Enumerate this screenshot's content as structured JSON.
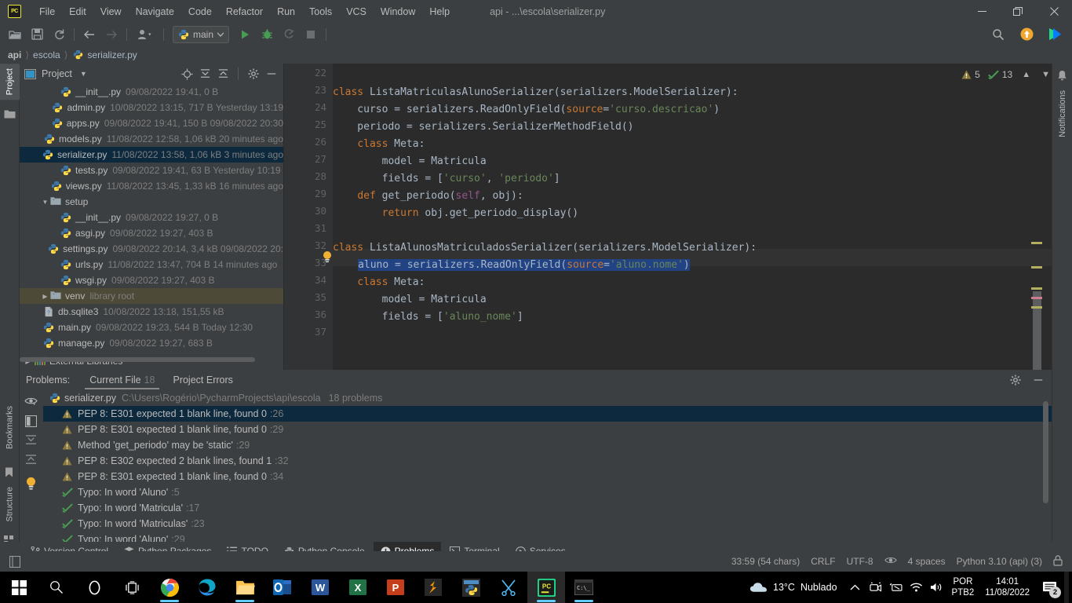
{
  "titlebar": {
    "logo": "PC",
    "menus": [
      "File",
      "Edit",
      "View",
      "Navigate",
      "Code",
      "Refactor",
      "Run",
      "Tools",
      "VCS",
      "Window",
      "Help"
    ],
    "window_title": "api - ...\\escola\\serializer.py",
    "minimize": "minimize-icon",
    "maximize": "restore-icon",
    "close": "close-icon"
  },
  "toolbar": {
    "open_label": "open-folder-icon",
    "save_label": "save-icon",
    "sync_label": "sync-icon",
    "back_label": "back-arrow-icon",
    "forward_label": "forward-arrow-icon",
    "profile_label": "user-icon",
    "run_config": "main",
    "run_label": "run-icon",
    "debug_label": "debug-icon",
    "coverage_label": "coverage-icon",
    "stop_label": "stop-icon",
    "search_label": "search-icon",
    "update_label": "update-icon",
    "plugin_label": "plugin-icon"
  },
  "breadcrumb": {
    "items": [
      "api",
      "escola",
      "serializer.py"
    ]
  },
  "left_strip": {
    "project_tab": "Project",
    "bookmarks_tab": "Bookmarks",
    "structure_tab": "Structure"
  },
  "right_strip": {
    "notifications_tab": "Notifications"
  },
  "project_panel": {
    "title": "Project",
    "icons": [
      "locate-icon",
      "expand-all-icon",
      "collapse-all-icon",
      "gear-icon",
      "minimize-icon"
    ],
    "tree": [
      {
        "indent": 4,
        "icon": "python-file-icon",
        "name": "__init__.py",
        "meta": "09/08/2022 19:41, 0 B",
        "state": ""
      },
      {
        "indent": 4,
        "icon": "python-file-icon",
        "name": "admin.py",
        "meta": "10/08/2022 13:15, 717 B Yesterday 13:19",
        "state": ""
      },
      {
        "indent": 4,
        "icon": "python-file-icon",
        "name": "apps.py",
        "meta": "09/08/2022 19:41, 150 B 09/08/2022 20:30",
        "state": ""
      },
      {
        "indent": 4,
        "icon": "python-file-icon",
        "name": "models.py",
        "meta": "11/08/2022 12:58, 1,06 kB 20 minutes ago",
        "state": ""
      },
      {
        "indent": 4,
        "icon": "python-file-icon",
        "name": "serializer.py",
        "meta": "11/08/2022 13:58, 1,06 kB 3 minutes ago",
        "state": "selected"
      },
      {
        "indent": 4,
        "icon": "python-file-icon",
        "name": "tests.py",
        "meta": "09/08/2022 19:41, 63 B Yesterday 10:19",
        "state": ""
      },
      {
        "indent": 4,
        "icon": "python-file-icon",
        "name": "views.py",
        "meta": "11/08/2022 13:45, 1,33 kB 16 minutes ago",
        "state": ""
      },
      {
        "indent": 2,
        "icon": "folder-icon",
        "arrow": "expanded",
        "name": "setup",
        "meta": "",
        "state": ""
      },
      {
        "indent": 4,
        "icon": "python-file-icon",
        "name": "__init__.py",
        "meta": "09/08/2022 19:27, 0 B",
        "state": ""
      },
      {
        "indent": 4,
        "icon": "python-file-icon",
        "name": "asgi.py",
        "meta": "09/08/2022 19:27, 403 B",
        "state": ""
      },
      {
        "indent": 4,
        "icon": "python-file-icon",
        "name": "settings.py",
        "meta": "09/08/2022 20:14, 3,4 kB 09/08/2022 20:",
        "state": ""
      },
      {
        "indent": 4,
        "icon": "python-file-icon",
        "name": "urls.py",
        "meta": "11/08/2022 13:47, 704 B 14 minutes ago",
        "state": ""
      },
      {
        "indent": 4,
        "icon": "python-file-icon",
        "name": "wsgi.py",
        "meta": "09/08/2022 19:27, 403 B",
        "state": ""
      },
      {
        "indent": 2,
        "icon": "folder-icon",
        "arrow": "collapsed",
        "name": "venv",
        "meta": "library root",
        "state": "highlight"
      },
      {
        "indent": 2,
        "icon": "db-file-icon",
        "name": "db.sqlite3",
        "meta": "10/08/2022 13:18, 151,55 kB",
        "state": ""
      },
      {
        "indent": 2,
        "icon": "python-file-icon",
        "name": "main.py",
        "meta": "09/08/2022 19:23, 544 B Today 12:30",
        "state": ""
      },
      {
        "indent": 2,
        "icon": "python-file-icon",
        "name": "manage.py",
        "meta": "09/08/2022 19:27, 683 B",
        "state": ""
      }
    ],
    "external_libraries": "External Libraries"
  },
  "editor": {
    "inspection_warnings": "5",
    "inspection_typos": "13",
    "first_line_number": 22,
    "lines": [
      {
        "n": 22,
        "text": ""
      },
      {
        "n": 23,
        "text": "class ListaMatriculasAlunoSerializer(serializers.ModelSerializer):"
      },
      {
        "n": 24,
        "text": "    curso = serializers.ReadOnlyField(source='curso.descricao')"
      },
      {
        "n": 25,
        "text": "    periodo = serializers.SerializerMethodField()"
      },
      {
        "n": 26,
        "text": "    class Meta:"
      },
      {
        "n": 27,
        "text": "        model = Matricula"
      },
      {
        "n": 28,
        "text": "        fields = ['curso', 'periodo']"
      },
      {
        "n": 29,
        "text": "    def get_periodo(self, obj):"
      },
      {
        "n": 30,
        "text": "        return obj.get_periodo_display()"
      },
      {
        "n": 31,
        "text": ""
      },
      {
        "n": 32,
        "text": "class ListaAlunosMatriculadosSerializer(serializers.ModelSerializer):"
      },
      {
        "n": 33,
        "text": "    aluno = serializers.ReadOnlyField(source='aluno.nome')"
      },
      {
        "n": 34,
        "text": "    class Meta:"
      },
      {
        "n": 35,
        "text": "        model = Matricula"
      },
      {
        "n": 36,
        "text": "        fields = ['aluno_nome']"
      },
      {
        "n": 37,
        "text": ""
      }
    ],
    "caret_line": 33
  },
  "problems_panel": {
    "label": "Problems:",
    "tabs": [
      {
        "label": "Current File",
        "count": "18",
        "active": true
      },
      {
        "label": "Project Errors",
        "count": "",
        "active": false
      }
    ],
    "gear_icon": "gear-icon",
    "minimize_icon": "minimize-icon",
    "strip_icons": [
      "eye-icon",
      "preview-panel-icon",
      "expand-all-icon",
      "collapse-all-icon",
      "lightbulb-icon"
    ],
    "file_row": {
      "icon": "python-file-icon",
      "name": "serializer.py",
      "path": "C:\\Users\\Rogério\\PycharmProjects\\api\\escola",
      "count": "18 problems"
    },
    "items": [
      {
        "severity": "warning",
        "text": "PEP 8: E301 expected 1 blank line, found 0",
        "loc": ":26",
        "selected": true
      },
      {
        "severity": "warning",
        "text": "PEP 8: E301 expected 1 blank line, found 0",
        "loc": ":29",
        "selected": false
      },
      {
        "severity": "warning",
        "text": "Method 'get_periodo' may be 'static'",
        "loc": ":29",
        "selected": false
      },
      {
        "severity": "warning",
        "text": "PEP 8: E302 expected 2 blank lines, found 1",
        "loc": ":32",
        "selected": false
      },
      {
        "severity": "warning",
        "text": "PEP 8: E301 expected 1 blank line, found 0",
        "loc": ":34",
        "selected": false
      },
      {
        "severity": "typo",
        "text": "Typo: In word 'Aluno'",
        "loc": ":5",
        "selected": false
      },
      {
        "severity": "typo",
        "text": "Typo: In word 'Matricula'",
        "loc": ":17",
        "selected": false
      },
      {
        "severity": "typo",
        "text": "Typo: In word 'Matriculas'",
        "loc": ":23",
        "selected": false
      }
    ]
  },
  "tool_window_bar": {
    "tabs": [
      {
        "label": "Version Control",
        "icon": "branch-icon",
        "active": false
      },
      {
        "label": "Python Packages",
        "icon": "packages-icon",
        "active": false
      },
      {
        "label": "TODO",
        "icon": "list-icon",
        "active": false
      },
      {
        "label": "Python Console",
        "icon": "python-icon",
        "active": false
      },
      {
        "label": "Problems",
        "icon": "problems-icon",
        "active": true
      },
      {
        "label": "Terminal",
        "icon": "terminal-icon",
        "active": false
      },
      {
        "label": "Services",
        "icon": "services-icon",
        "active": false
      }
    ]
  },
  "status_bar": {
    "left_icon": "layout-icon",
    "caret_position": "33:59 (54 chars)",
    "line_separator": "CRLF",
    "encoding": "UTF-8",
    "reader_mode_icon": "eye-icon",
    "indent": "4 spaces",
    "interpreter": "Python 3.10 (api) (3)",
    "lock_icon": "lock-icon"
  },
  "taskbar": {
    "items": [
      {
        "name": "start-button",
        "icon": "windows-logo"
      },
      {
        "name": "search-button",
        "icon": "search-icon"
      },
      {
        "name": "cortana-button",
        "icon": "circle-icon"
      },
      {
        "name": "task-view-button",
        "icon": "task-view-icon"
      },
      {
        "name": "chrome-button",
        "icon": "chrome-icon",
        "running": true
      },
      {
        "name": "edge-button",
        "icon": "edge-icon",
        "running": false
      },
      {
        "name": "file-explorer-button",
        "icon": "folder-icon",
        "running": true
      },
      {
        "name": "outlook-button",
        "icon": "outlook-icon",
        "running": false
      },
      {
        "name": "word-button",
        "icon": "word-icon",
        "running": false
      },
      {
        "name": "excel-button",
        "icon": "excel-icon",
        "running": false
      },
      {
        "name": "powerpoint-button",
        "icon": "powerpoint-icon",
        "running": false
      },
      {
        "name": "sublime-button",
        "icon": "sublime-icon",
        "running": false
      },
      {
        "name": "python-ide-button",
        "icon": "python-icon",
        "running": false
      },
      {
        "name": "snipping-tool-button",
        "icon": "snip-icon",
        "running": false
      },
      {
        "name": "pycharm-button",
        "icon": "pycharm-icon",
        "running": true,
        "active": true
      },
      {
        "name": "terminal-button",
        "icon": "cmd-icon",
        "running": true
      }
    ],
    "weather": {
      "temperature": "13°C",
      "condition": "Nublado",
      "icon": "cloud-icon"
    },
    "tray": {
      "chevron": "show-hidden-icons",
      "meet": "camera-icon",
      "vpn": "vpn-icon",
      "wifi": "wifi-icon",
      "volume": "volume-icon"
    },
    "locale": {
      "line1": "POR",
      "line2": "PTB2"
    },
    "clock": {
      "time": "14:01",
      "date": "11/08/2022"
    },
    "notifications": {
      "count": "2",
      "icon": "notifications-icon"
    }
  },
  "colors": {
    "panel_bg": "#3c3f41",
    "editor_bg": "#2b2b2b",
    "gutter_bg": "#313335",
    "selection": "#214283",
    "row_selected": "#0d293e",
    "text": "#bbbbbb",
    "muted": "#7c7c7c",
    "keyword": "#cc7832",
    "string": "#6a8759",
    "self_kw": "#94558d",
    "accent_green": "#499c54",
    "warning": "#bbb529"
  }
}
